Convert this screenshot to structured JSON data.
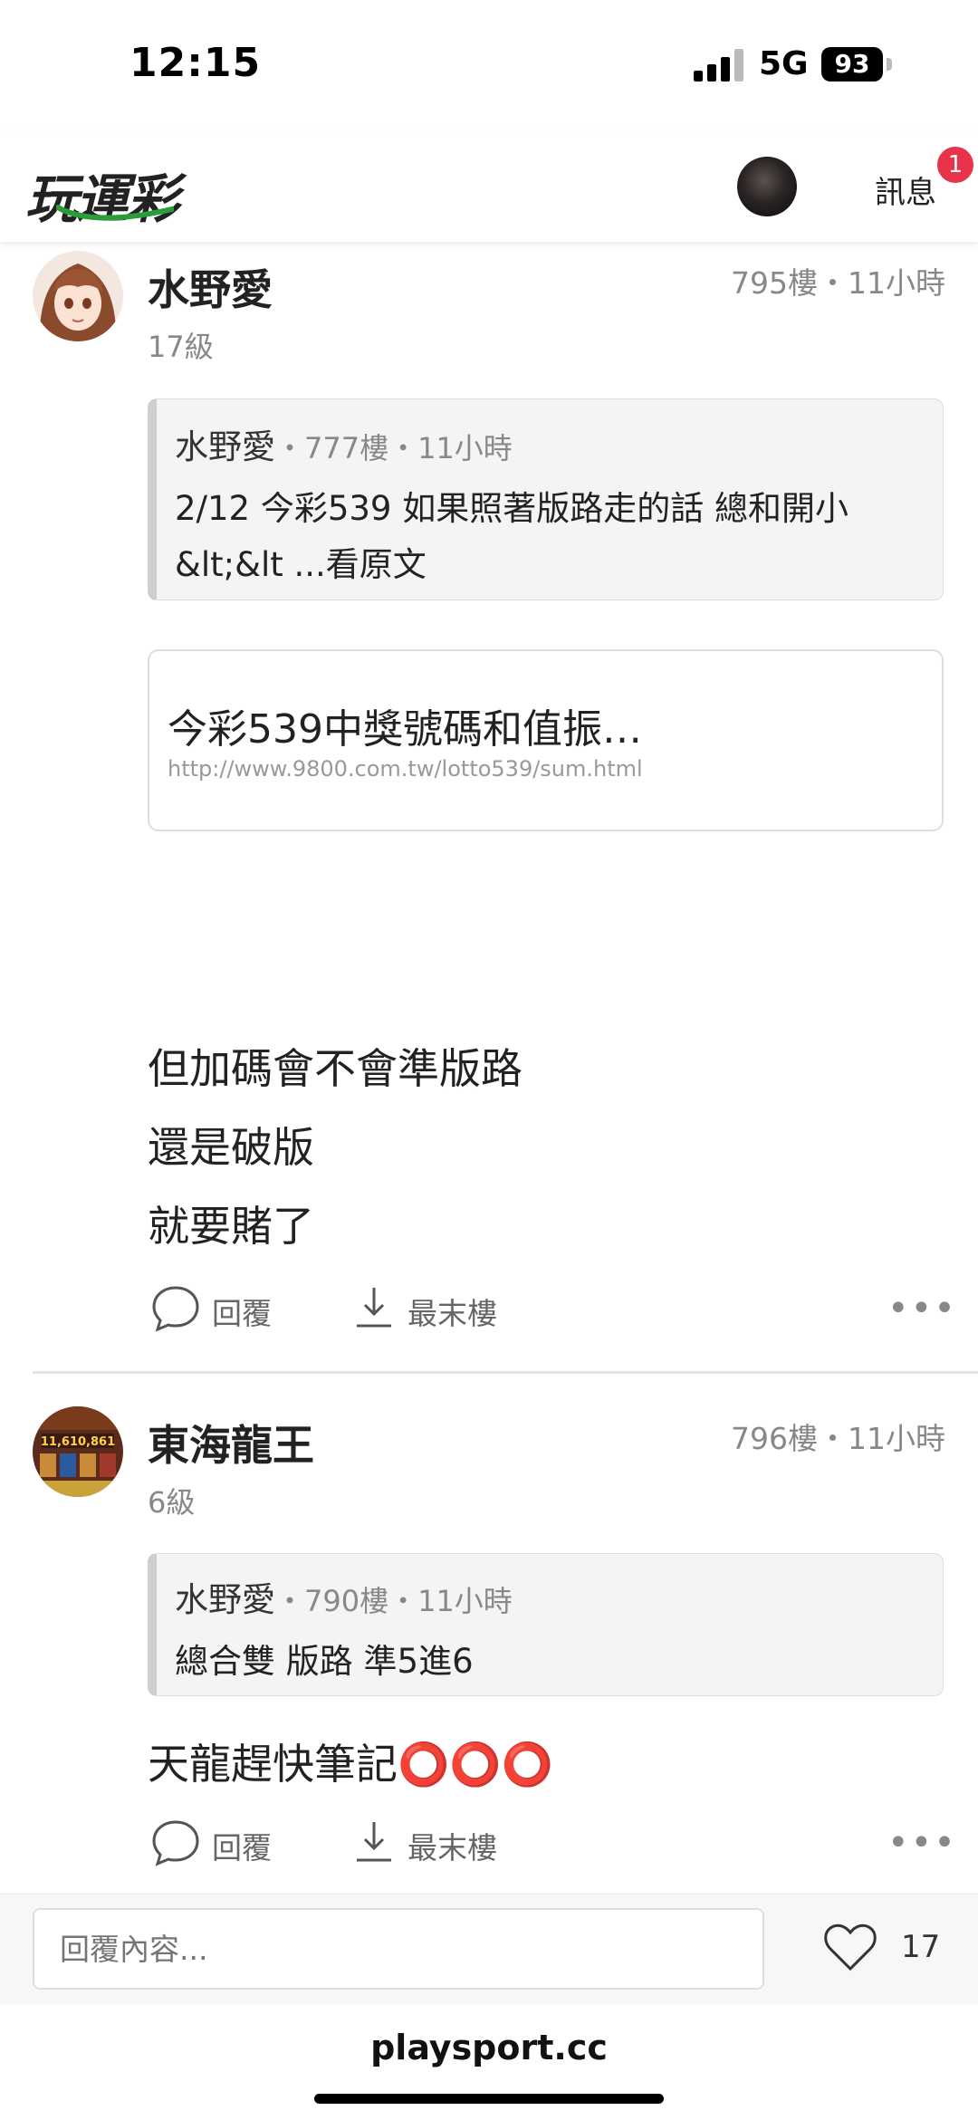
{
  "status_bar": {
    "time": "12:15",
    "network": "5G",
    "battery": "93"
  },
  "header": {
    "logo_text": "玩運彩",
    "messages_label": "訊息",
    "messages_badge": "1"
  },
  "posts": [
    {
      "username": "水野愛",
      "level": "17級",
      "floor": "795樓・11小時",
      "quote": {
        "name": "水野愛",
        "meta": "・777樓・11小時",
        "lines": [
          "2/12  今彩539 如果照著版路走的話 總和開小",
          "&lt;&lt ...看原文"
        ]
      },
      "link": {
        "title": "今彩539中獎號碼和值振…",
        "url": "http://www.9800.com.tw/lotto539/sum.html"
      },
      "body": [
        "但加碼會不會準版路",
        "還是破版",
        "就要賭了"
      ],
      "actions": {
        "reply": "回覆",
        "last_floor": "最末樓",
        "more": "•••"
      }
    },
    {
      "username": "東海龍王",
      "level": "6級",
      "floor": "796樓・11小時",
      "quote": {
        "name": "水野愛",
        "meta": "・790樓・11小時",
        "lines": [
          "總合雙 版路 準5進6"
        ]
      },
      "body": [
        "天龍趕快筆記⭕⭕⭕"
      ],
      "actions": {
        "reply": "回覆",
        "last_floor": "最末樓",
        "more": "•••"
      }
    }
  ],
  "reply_bar": {
    "placeholder": "回覆內容...",
    "like_count": "17"
  },
  "browser": {
    "domain": "playsport.cc"
  },
  "colors": {
    "badge": "#e8334a",
    "logo_swoosh": "#2a9d3a"
  }
}
